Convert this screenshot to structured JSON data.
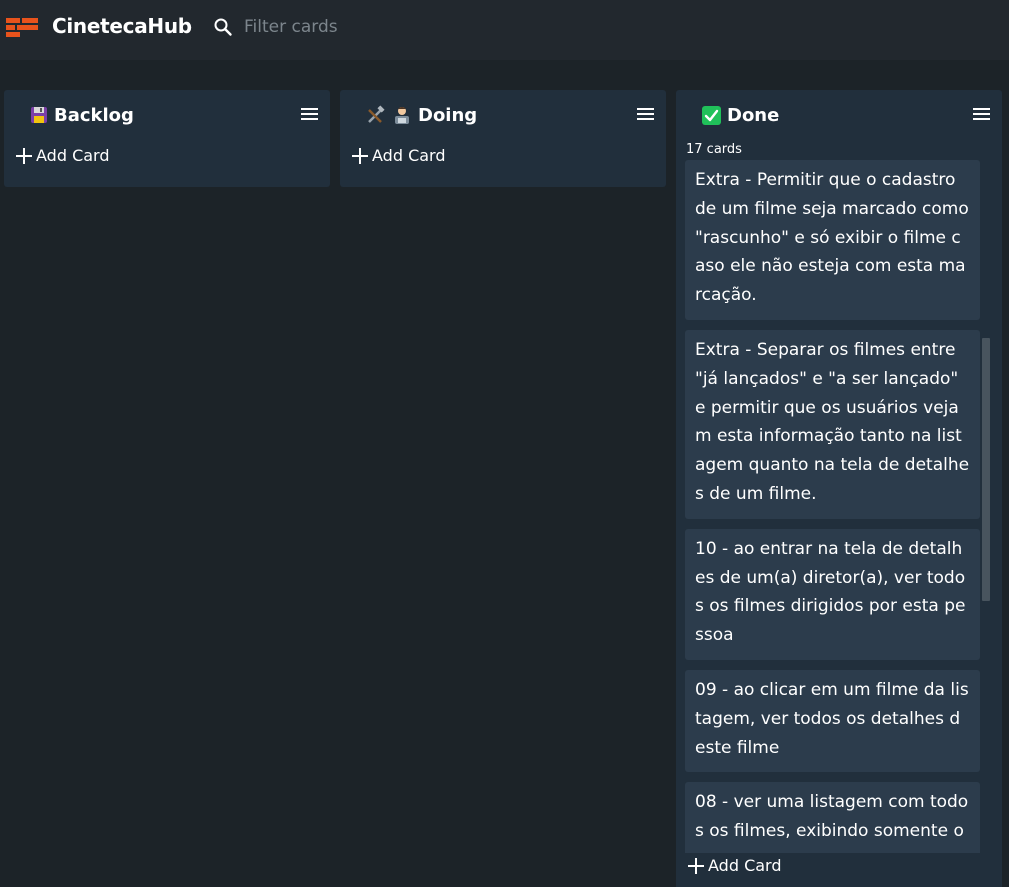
{
  "app": {
    "title": "CinetecaHub"
  },
  "search": {
    "placeholder": "Filter cards",
    "value": ""
  },
  "colors": {
    "background": "#1c2328",
    "topbar": "#22282e",
    "column": "#212f3c",
    "card": "#2c3c4c",
    "logo": "#e8531c",
    "done_check": "#20c15a"
  },
  "columns": [
    {
      "title": "Backlog",
      "icon": "floppy-disk-icon",
      "add_card_label": "Add Card"
    },
    {
      "title": "Doing",
      "icon": "tools-and-technologist-icon",
      "add_card_label": "Add Card"
    },
    {
      "title": "Done",
      "icon": "check-mark-icon",
      "card_count": "17 cards",
      "add_card_label": "Add Card",
      "cards": [
        "Extra - Permitir que o cadastro de um filme seja marcado como \"rascunho\" e só exibir o filme caso ele não esteja com esta marcação.",
        "Extra - Separar os filmes entre \"já lançados\" e \"a ser lançado\" e permitir que os usuários vejam esta informação tanto na listagem quanto na tela de detalhes de um filme.",
        "10 - ao entrar na tela de detalhes de um(a) diretor(a), ver todos os filmes dirigidos por esta pessoa",
        "09 - ao clicar em um filme da listagem, ver todos os detalhes deste filme",
        "08 - ver uma listagem com todos os filmes, exibindo somente o"
      ]
    }
  ]
}
